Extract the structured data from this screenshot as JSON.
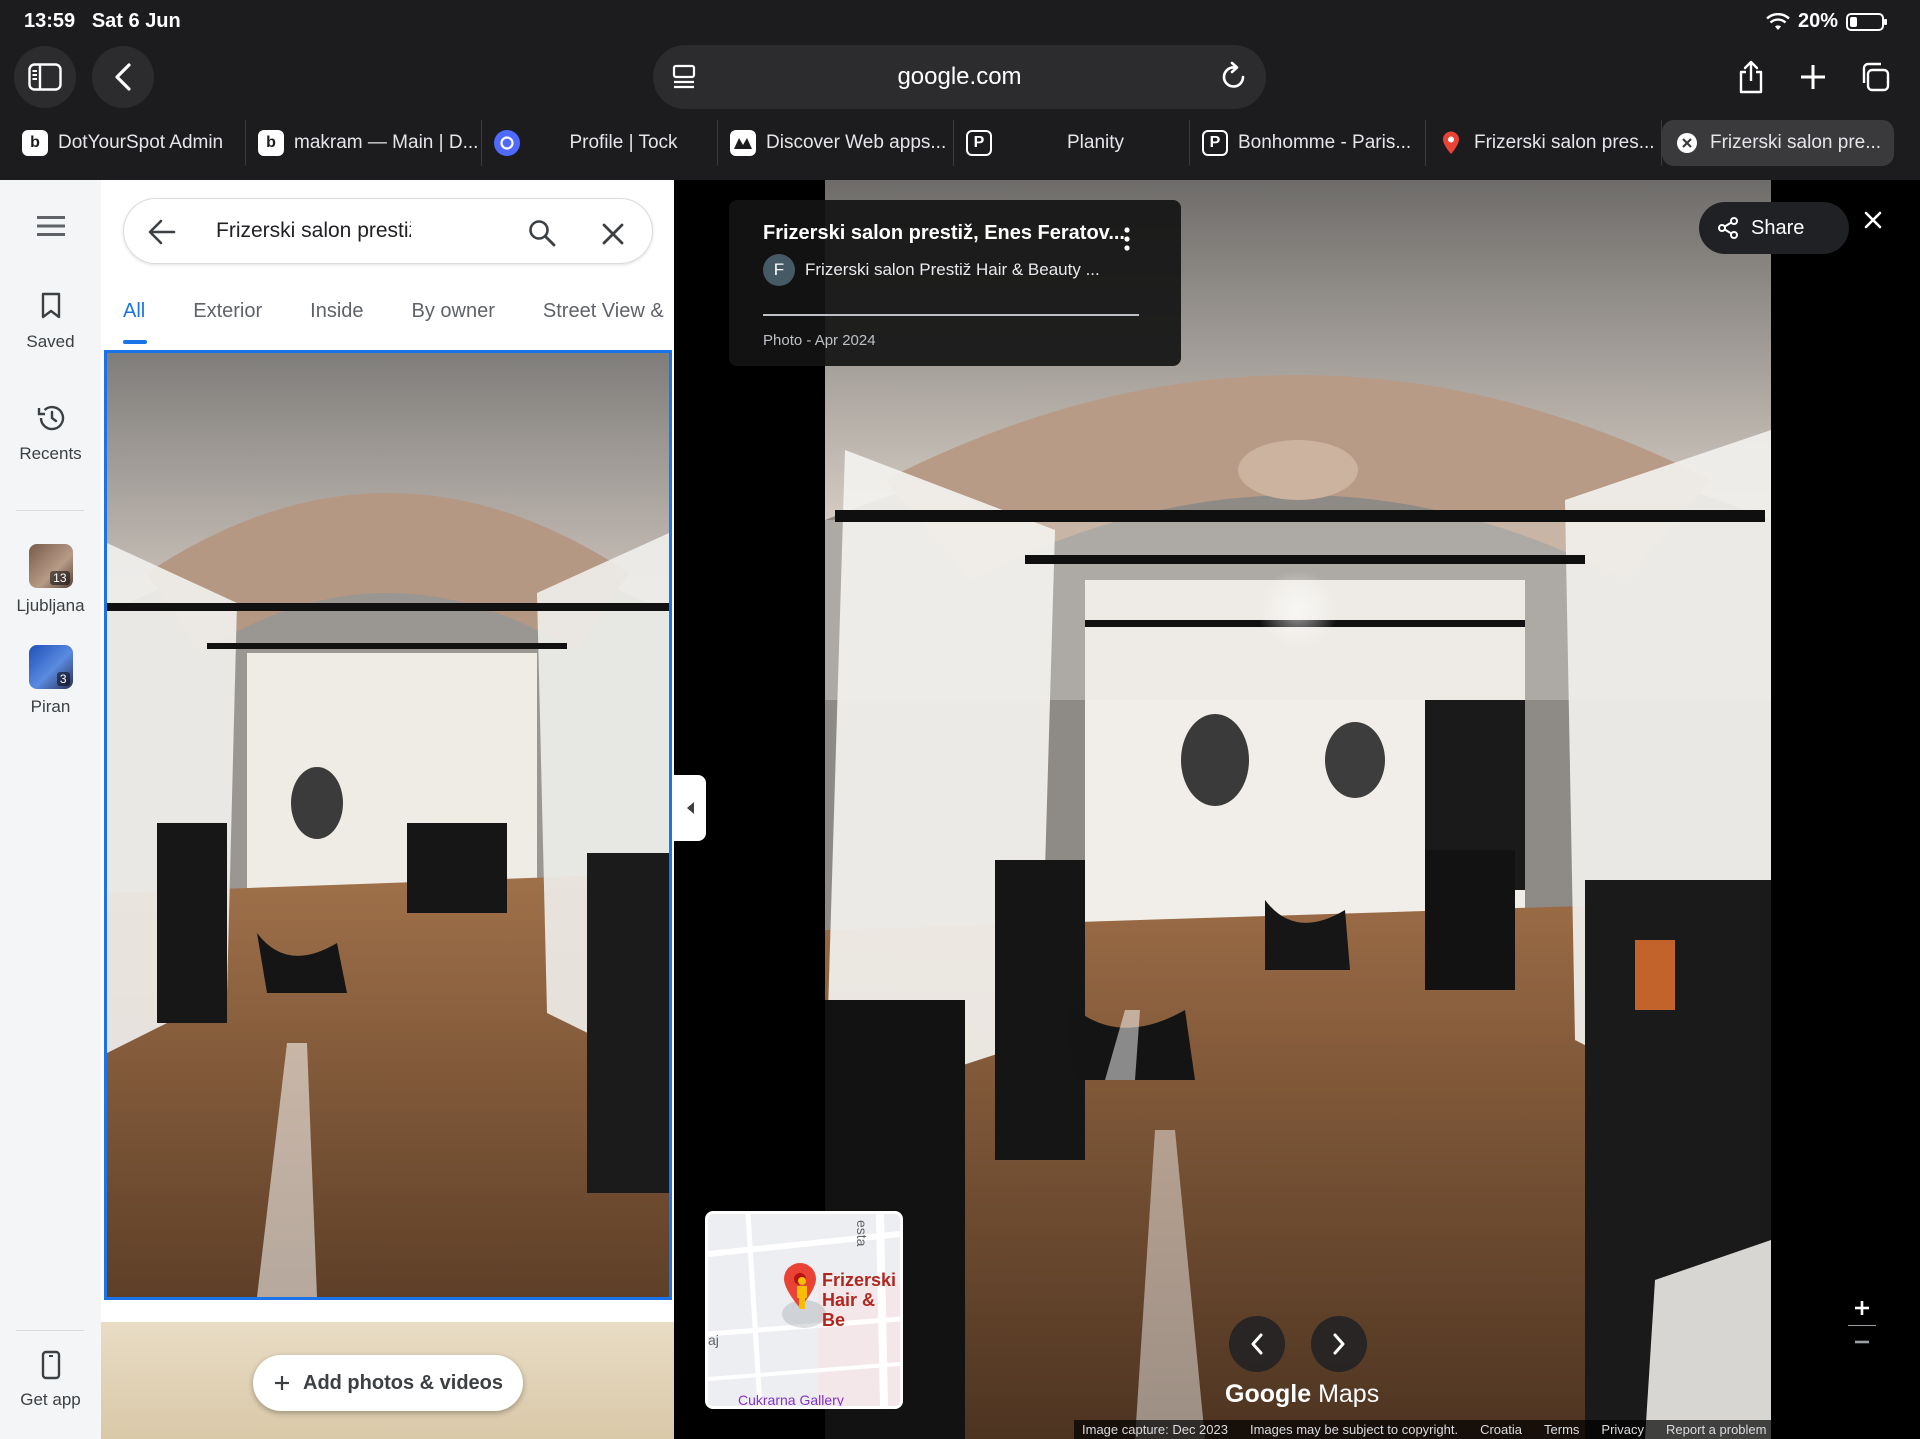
{
  "status_bar": {
    "time": "13:59",
    "date": "Sat 6 Jun",
    "battery": "20%"
  },
  "browser": {
    "address": "google.com",
    "tabs": [
      {
        "label": "DotYourSpot Admin",
        "icon_text": "b",
        "icon_color": "#ffffff"
      },
      {
        "label": "makram — Main | D...",
        "icon_text": "b",
        "icon_color": "#ffffff"
      },
      {
        "label": "Profile | Tock",
        "icon_text": "",
        "icon_color": "#4f6bff"
      },
      {
        "label": "Discover Web apps...",
        "icon_text": "",
        "icon_color": "#ffffff"
      },
      {
        "label": "Planity",
        "icon_text": "P",
        "icon_color": "#ffffff"
      },
      {
        "label": "Bonhomme - Paris...",
        "icon_text": "P",
        "icon_color": "#ffffff"
      },
      {
        "label": "Frizerski salon pres...",
        "icon_text": "",
        "icon_color": "#ea4335"
      },
      {
        "label": "Frizerski salon pre...",
        "icon_text": "",
        "icon_color": "#ffffff"
      }
    ]
  },
  "rail": {
    "saved": "Saved",
    "recents": "Recents",
    "places": [
      {
        "label": "Ljubljana",
        "count": "13"
      },
      {
        "label": "Piran",
        "count": "3"
      }
    ],
    "get_app": "Get app"
  },
  "panel": {
    "search_text": "Frizerski salon prestiž, Enes Feratovi",
    "chips": [
      "All",
      "Exterior",
      "Inside",
      "By owner",
      "Street View &"
    ],
    "add_photos": "Add photos & videos"
  },
  "viewer": {
    "title": "Frizerski salon prestiž, Enes Feratov...",
    "author_initial": "F",
    "author": "Frizerski salon Prestiž Hair & Beauty ...",
    "date": "Photo - Apr 2024",
    "share": "Share",
    "minimap_label": "Frizerski Hair & Be",
    "minimap_road": "esta",
    "minimap_poi": "Cukrarna Gallery",
    "minimap_edge": "aj",
    "logo_google": "Google",
    "logo_maps": "Maps",
    "footer": [
      "Image capture: Dec 2023",
      "Images may be subject to copyright.",
      "Croatia",
      "Terms",
      "Privacy",
      "Report a problem"
    ]
  },
  "colors": {
    "accent": "#1a73e8",
    "pin": "#ea4335"
  }
}
